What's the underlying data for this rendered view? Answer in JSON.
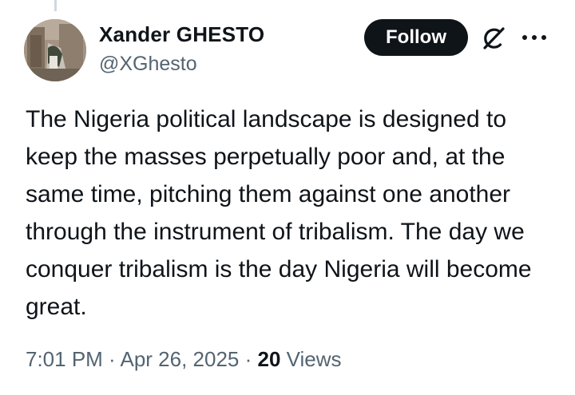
{
  "author": {
    "display_name": "Xander GHESTO",
    "handle": "@XGhesto"
  },
  "actions": {
    "follow_label": "Follow",
    "grok_icon": "grok-icon",
    "more_icon": "more-icon"
  },
  "tweet": {
    "text": "The Nigeria political landscape is designed to keep the masses perpetually poor and, at the same time, pitching them against one another through the instrument of tribalism. The day we conquer tribalism is the day Nigeria will become great."
  },
  "meta": {
    "time": "7:01 PM",
    "separator_1": " · ",
    "date": "Apr 26, 2025",
    "separator_2": " · ",
    "views_count": "20",
    "views_label": " Views"
  },
  "colors": {
    "text_primary": "#0f1419",
    "text_secondary": "#536471",
    "follow_bg": "#0f1419",
    "follow_text": "#ffffff"
  }
}
